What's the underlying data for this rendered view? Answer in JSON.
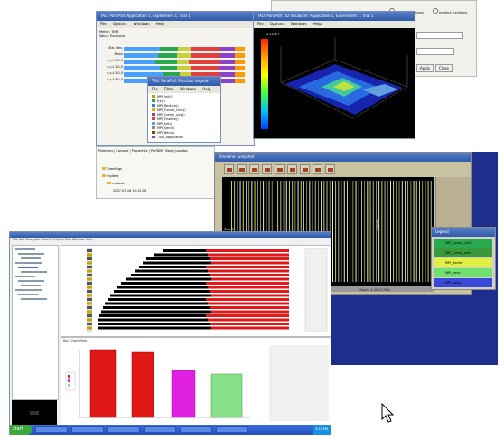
{
  "backdrop_color": "#1e2e8c",
  "prop_panel": {
    "buttons": [
      "Apply",
      "Close"
    ],
    "radio_labels": [
      "Manual Functions",
      "Indirect Functions"
    ]
  },
  "paraprof_window": {
    "title": "TAU: ParaProf: Application 1, Experiment 1, Trial 1",
    "menu": [
      "File",
      "Options",
      "Windows",
      "Help"
    ],
    "header_lines": [
      "Metric: TIME",
      "Value: Exclusive"
    ],
    "row_labels": [
      "Std. Dev.",
      "Mean",
      "n,c,t 0,0,0",
      "n,c,t 1,0,0",
      "n,c,t 2,0,0",
      "n,c,t 3,0,0"
    ],
    "bar_colors": [
      "#4aa0ff",
      "#2aa850",
      "#c8d040",
      "#e04040",
      "#8844cc",
      "#ff9900"
    ],
    "bottom_tabs": "Problems | Console | Properties | PerfDMF View | Javadoc",
    "tree_items": [
      "Greetings",
      "mpitest",
      "mpitest"
    ],
    "tree_date": "2007-07-16 16:12:08"
  },
  "legend_window": {
    "title": "TAU: ParaProf: Function Legend",
    "menu": [
      "File",
      "Filter",
      "Windows",
      "Help"
    ],
    "items": [
      {
        "label": "MPI_Init()",
        "color": "#c8a000"
      },
      {
        "label": "f(x)()",
        "color": "#2aa850"
      },
      {
        "label": "MPI_Reduce()",
        "color": "#3a7ad8"
      },
      {
        "label": "MPI_Comm_rank()",
        "color": "#ff9900"
      },
      {
        "label": "MPI_Comm_size()",
        "color": "#aa3388"
      },
      {
        "label": "MPI_Finalize()",
        "color": "#e04040"
      },
      {
        "label": "MPI_Init()",
        "color": "#4aa0ff"
      },
      {
        "label": "MPI_Send()",
        "color": "#888888"
      },
      {
        "label": "MPI_Recv()",
        "color": "#884400"
      },
      {
        "label": ".TAU_application",
        "color": "#8844cc"
      }
    ]
  },
  "viz3d": {
    "title": "TAU: ParaProf: 3D Visualizer: Application 1, Experiment 1, Trial 1",
    "menu": [
      "File",
      "Options",
      "Windows",
      "Help"
    ],
    "scale_top": "2.113E7"
  },
  "jumpshot": {
    "title": "TimeLine: Jumpshot",
    "task_label": "Task 0",
    "readout": "Zoom: 4.30 (3.264)",
    "axis_text": "mpitest"
  },
  "jumpshot_legend": {
    "title": "Legend",
    "items": [
      {
        "label": "MPI_Comm_rank",
        "color": "#2aa850"
      },
      {
        "label": "MPI_Comm_size",
        "color": "#3a9a3a"
      },
      {
        "label": "MPI_Barrier",
        "color": "#e0f040"
      },
      {
        "label": "MPI_Irecv",
        "color": "#70e070"
      },
      {
        "label": "MPI_Isend",
        "color": "#3a4ad8"
      }
    ]
  },
  "eclipse": {
    "top_strip": "File  Edit  Navigate  Search  Project  Run  Window  Help",
    "lower_tab": "Bar Chart View"
  },
  "taskbar": {
    "start_label": "start",
    "clock": "4:11 PM"
  }
}
